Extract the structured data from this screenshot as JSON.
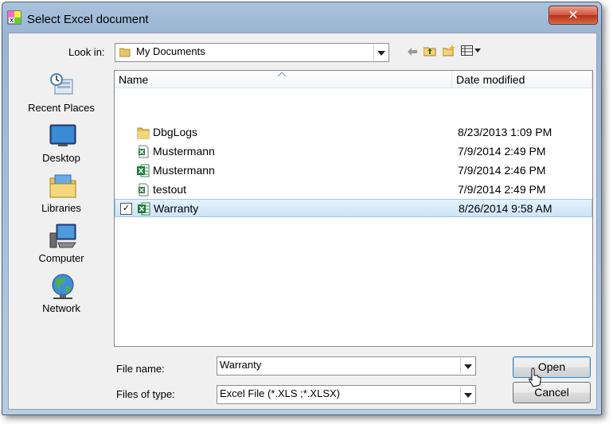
{
  "window": {
    "title": "Select Excel document",
    "close_symbol": "✕"
  },
  "look_in": {
    "label": "Look in:",
    "value": "My Documents"
  },
  "places": [
    {
      "label": "Recent Places",
      "icon": "recent-places-icon"
    },
    {
      "label": "Desktop",
      "icon": "desktop-icon"
    },
    {
      "label": "Libraries",
      "icon": "libraries-icon"
    },
    {
      "label": "Computer",
      "icon": "computer-icon"
    },
    {
      "label": "Network",
      "icon": "network-icon"
    }
  ],
  "columns": {
    "name": "Name",
    "date": "Date modified"
  },
  "files": [
    {
      "name": "DbgLogs",
      "date": "8/23/2013 1:09 PM",
      "icon": "folder-icon",
      "selected": false
    },
    {
      "name": "Mustermann",
      "date": "7/9/2014 2:49 PM",
      "icon": "excel-xls-file-icon",
      "selected": false
    },
    {
      "name": "Mustermann",
      "date": "7/9/2014 2:46 PM",
      "icon": "excel-xlsx-file-icon",
      "selected": false
    },
    {
      "name": "testout",
      "date": "7/9/2014 2:49 PM",
      "icon": "excel-xls-file-icon",
      "selected": false
    },
    {
      "name": "Warranty",
      "date": "8/26/2014 9:58 AM",
      "icon": "excel-xlsx-file-icon",
      "selected": true
    }
  ],
  "file_name": {
    "label": "File name:",
    "value": "Warranty"
  },
  "file_type": {
    "label": "Files of type:",
    "value": "Excel File (*.XLS ;*.XLSX)"
  },
  "buttons": {
    "open": "Open",
    "cancel": "Cancel"
  },
  "colors": {
    "selection": "#cce4f7",
    "title_bar": "#9ab5d2",
    "excel_green": "#1e7a3c"
  }
}
